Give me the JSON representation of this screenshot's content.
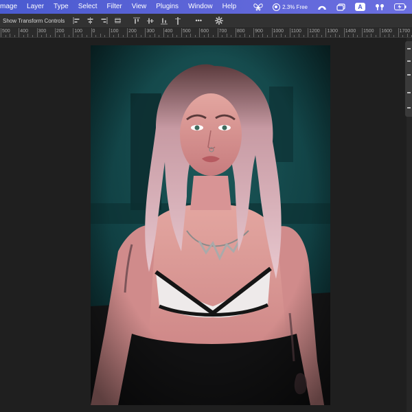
{
  "menubar": {
    "menus": [
      "mage",
      "Layer",
      "Type",
      "Select",
      "Filter",
      "View",
      "Plugins",
      "Window",
      "Help"
    ],
    "memory_text": "2.3% Free",
    "status_icons": [
      "butterfly-icon",
      "memory-icon",
      "arc-icon",
      "window-icon",
      "input-source-icon",
      "airpods-icon",
      "battery-icon"
    ],
    "input_source_label": "A"
  },
  "optionsbar": {
    "show_transform_label": "Show Transform Controls",
    "align_icons": [
      "align-left-icon",
      "align-center-icon",
      "align-right-icon",
      "align-top-icon",
      "align-middle-icon",
      "align-bottom-icon",
      "distribute-left-icon",
      "distribute-right-icon"
    ],
    "more_label": "•••"
  },
  "ruler": {
    "labels": [
      "500",
      "400",
      "300",
      "200",
      "100",
      "0",
      "100",
      "200",
      "300",
      "400",
      "500",
      "600",
      "700",
      "800",
      "900",
      "1000",
      "1100",
      "1200",
      "1300",
      "1400",
      "1500",
      "1600",
      "1700"
    ]
  },
  "colors": {
    "menubar_accent": "#5a63d6",
    "canvas_bg": "#1f1f1f",
    "photo_bg": "#0f3b3d"
  }
}
